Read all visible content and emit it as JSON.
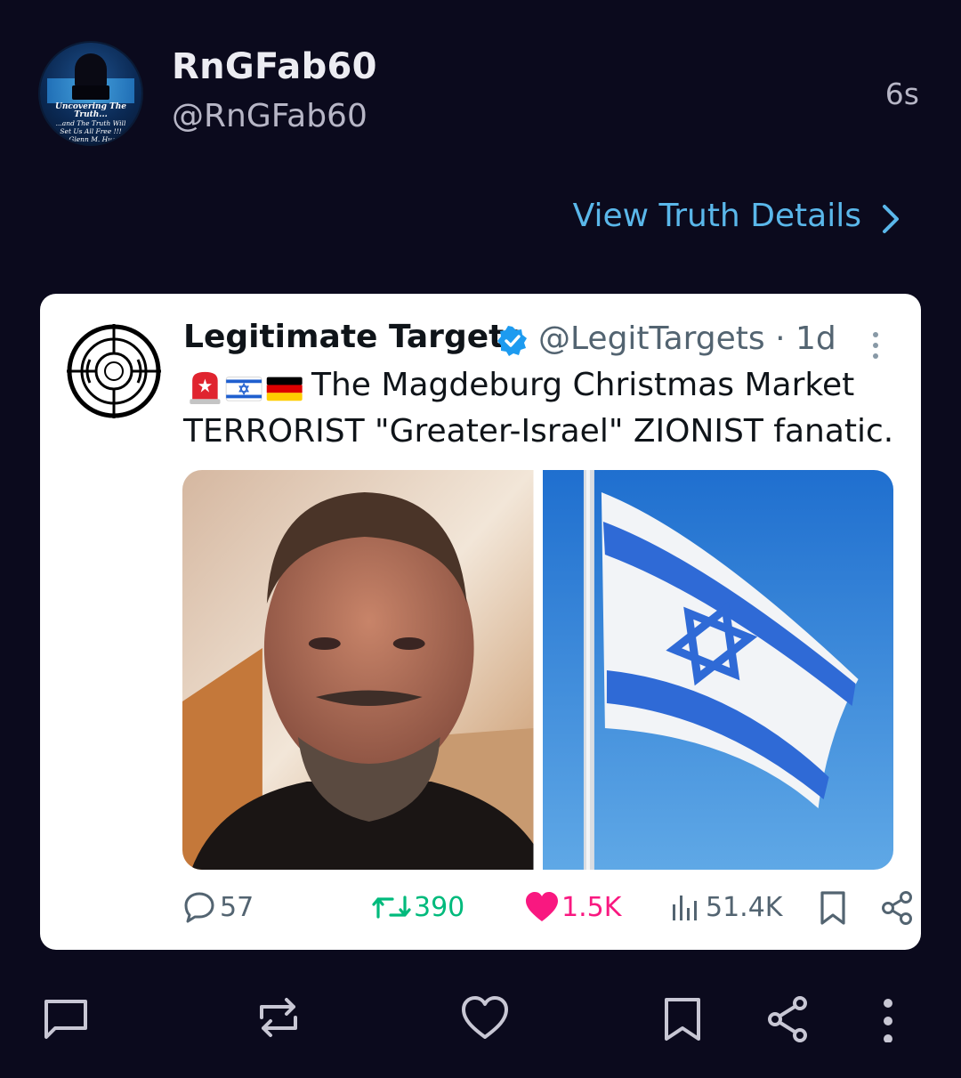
{
  "post": {
    "display_name": "RnGFab60",
    "handle": "@RnGFab60",
    "time": "6s",
    "avatar_text": [
      "Uncovering The Truth...",
      "...and The Truth Will",
      "Set Us All Free !!!",
      "~ Glenn M. Hugo"
    ],
    "view_details_label": "View Truth Details"
  },
  "embedded": {
    "name": "Legitimate Targets",
    "handle_time": "@LegitTargets · 1d",
    "text_line1": "The Magdeburg Christmas Market",
    "text_line2": "TERRORIST \"Greater-Israel\" ZIONIST fanatic.",
    "emojis": [
      "police-light",
      "israel-flag",
      "germany-flag"
    ],
    "stats": {
      "replies": "57",
      "reposts": "390",
      "likes": "1.5K",
      "views": "51.4K"
    },
    "colors": {
      "repost": "#00ba7c",
      "like": "#f91880",
      "verified": "#1d9bf0",
      "muted": "#536471"
    }
  },
  "theme": {
    "background": "#0b0a1d",
    "accent": "#5ab7ea"
  }
}
